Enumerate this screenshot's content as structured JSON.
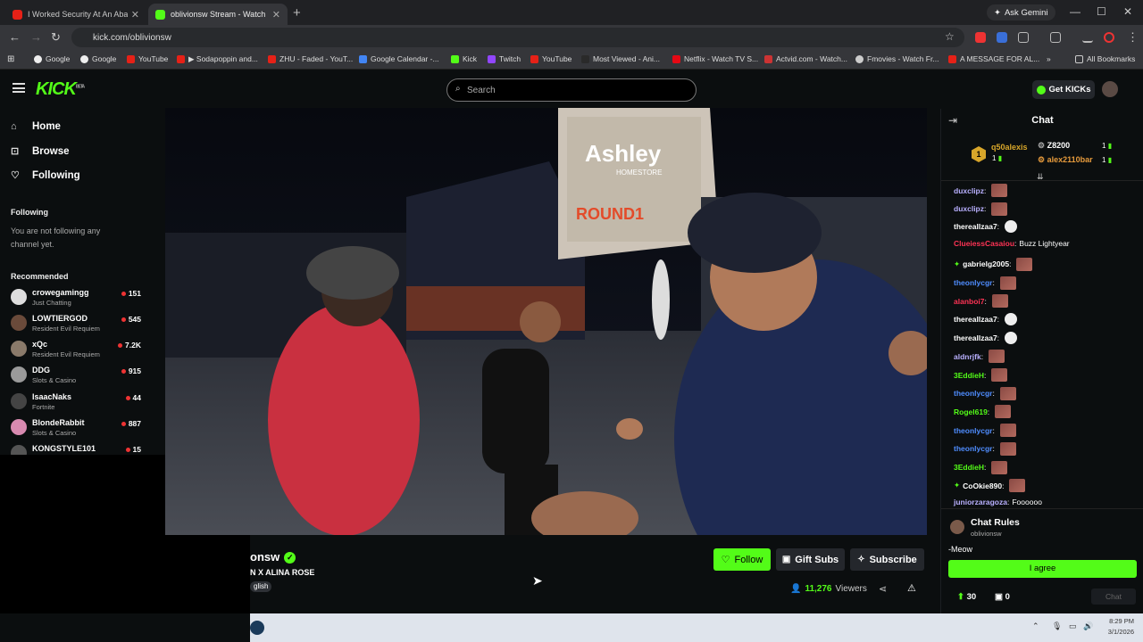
{
  "browser": {
    "tabs": [
      {
        "title": "I Worked Security At An Aband",
        "active": false
      },
      {
        "title": "oblivionsw Stream - Watch",
        "active": true
      }
    ],
    "ask_gemini": "Ask Gemini",
    "url": "kick.com/oblivionsw",
    "bookmarks": [
      "Google",
      "Google",
      "YouTube",
      "▶ Sodapoppin and...",
      "ZHU - Faded - YouT...",
      "Google Calendar -...",
      "Kick",
      "Twitch",
      "YouTube",
      "Most Viewed - Ani...",
      "Netflix - Watch TV S...",
      "Actvid.com - Watch...",
      "Fmovies - Watch Fr...",
      "A MESSAGE FOR AL..."
    ],
    "all_bookmarks": "All Bookmarks"
  },
  "header": {
    "logo": "KICK",
    "logo_beta": "BETA",
    "search_placeholder": "Search",
    "get_kicks": "Get KICKs"
  },
  "sidebar": {
    "nav": [
      "Home",
      "Browse",
      "Following"
    ],
    "following_heading": "Following",
    "following_empty": "You are not following any channel yet.",
    "recommended_heading": "Recommended",
    "recommended": [
      {
        "name": "crowegamingg",
        "category": "Just Chatting",
        "viewers": "151"
      },
      {
        "name": "LOWTIERGOD",
        "category": "Resident Evil Requiem",
        "viewers": "545"
      },
      {
        "name": "xQc",
        "category": "Resident Evil Requiem",
        "viewers": "7.2K"
      },
      {
        "name": "DDG",
        "category": "Slots & Casino",
        "viewers": "915"
      },
      {
        "name": "IsaacNaks",
        "category": "Fortnite",
        "viewers": "44"
      },
      {
        "name": "BlondeRabbit",
        "category": "Slots & Casino",
        "viewers": "887"
      },
      {
        "name": "KONGSTYLE101",
        "category": "",
        "viewers": "15"
      }
    ]
  },
  "stream": {
    "channel_partial": "onsw",
    "title_partial": "N X ALINA ROSE",
    "language_partial": "glish",
    "follow": "Follow",
    "gift_subs": "Gift Subs",
    "subscribe": "Subscribe",
    "viewers_count": "11,276",
    "viewers_label": "Viewers",
    "sign_text": "Ashley",
    "sign_sub": "HOMESTORE",
    "round1": "ROUND1"
  },
  "chat": {
    "title": "Chat",
    "leaderboard": [
      {
        "rank": "1",
        "name": "q50alexis",
        "count": "1"
      },
      {
        "name": "Z8200",
        "count": "1"
      },
      {
        "name": "alex2110bar",
        "count": "1"
      }
    ],
    "messages": [
      {
        "user": "duxclipz",
        "text": "",
        "color": "#b9b0ff",
        "emote": "e"
      },
      {
        "user": "duxclipz",
        "text": "",
        "color": "#b9b0ff",
        "emote": "e"
      },
      {
        "user": "thereallzaa7",
        "text": "",
        "color": "#ffffff",
        "emote": "g"
      },
      {
        "user": "ClueiessCasaiou",
        "text": "Buzz Lightyear",
        "color": "#ff3355",
        "emote": ""
      },
      {
        "user": "gabrielg2005",
        "text": "",
        "color": "#ffffff",
        "emote": "e",
        "badge": true
      },
      {
        "user": "theonlycgr",
        "text": "",
        "color": "#4f8dff",
        "emote": "e"
      },
      {
        "user": "alanboi7",
        "text": "",
        "color": "#ff3355",
        "emote": "e"
      },
      {
        "user": "thereallzaa7",
        "text": "",
        "color": "#ffffff",
        "emote": "g"
      },
      {
        "user": "thereallzaa7",
        "text": "",
        "color": "#ffffff",
        "emote": "g"
      },
      {
        "user": "aldnrjfk",
        "text": "",
        "color": "#b9b0ff",
        "emote": "e"
      },
      {
        "user": "3EddieH",
        "text": "",
        "color": "#53fc18",
        "emote": "e"
      },
      {
        "user": "theonlycgr",
        "text": "",
        "color": "#4f8dff",
        "emote": "e"
      },
      {
        "user": "Rogel619",
        "text": "",
        "color": "#53fc18",
        "emote": "e"
      },
      {
        "user": "theonlycgr",
        "text": "",
        "color": "#4f8dff",
        "emote": "e"
      },
      {
        "user": "theonlycgr",
        "text": "",
        "color": "#4f8dff",
        "emote": "e"
      },
      {
        "user": "3EddieH",
        "text": "",
        "color": "#53fc18",
        "emote": "e"
      },
      {
        "user": "CoOkie890",
        "text": "",
        "color": "#ffffff",
        "emote": "e",
        "badge": true
      },
      {
        "user": "juniorzaragoza",
        "text": "Foooooo",
        "color": "#b9b0ff",
        "emote": ""
      }
    ],
    "rules_title": "Chat Rules",
    "rules_channel": "oblivionsw",
    "rules_text": "-Meow",
    "agree": "I agree",
    "kicks_count": "30",
    "gift_count": "0",
    "send": "Chat"
  },
  "taskbar": {
    "time": "8:29 PM",
    "date": "3/1/2026"
  },
  "colors": {
    "accent": "#53fc18",
    "bg": "#0b0e0f"
  }
}
